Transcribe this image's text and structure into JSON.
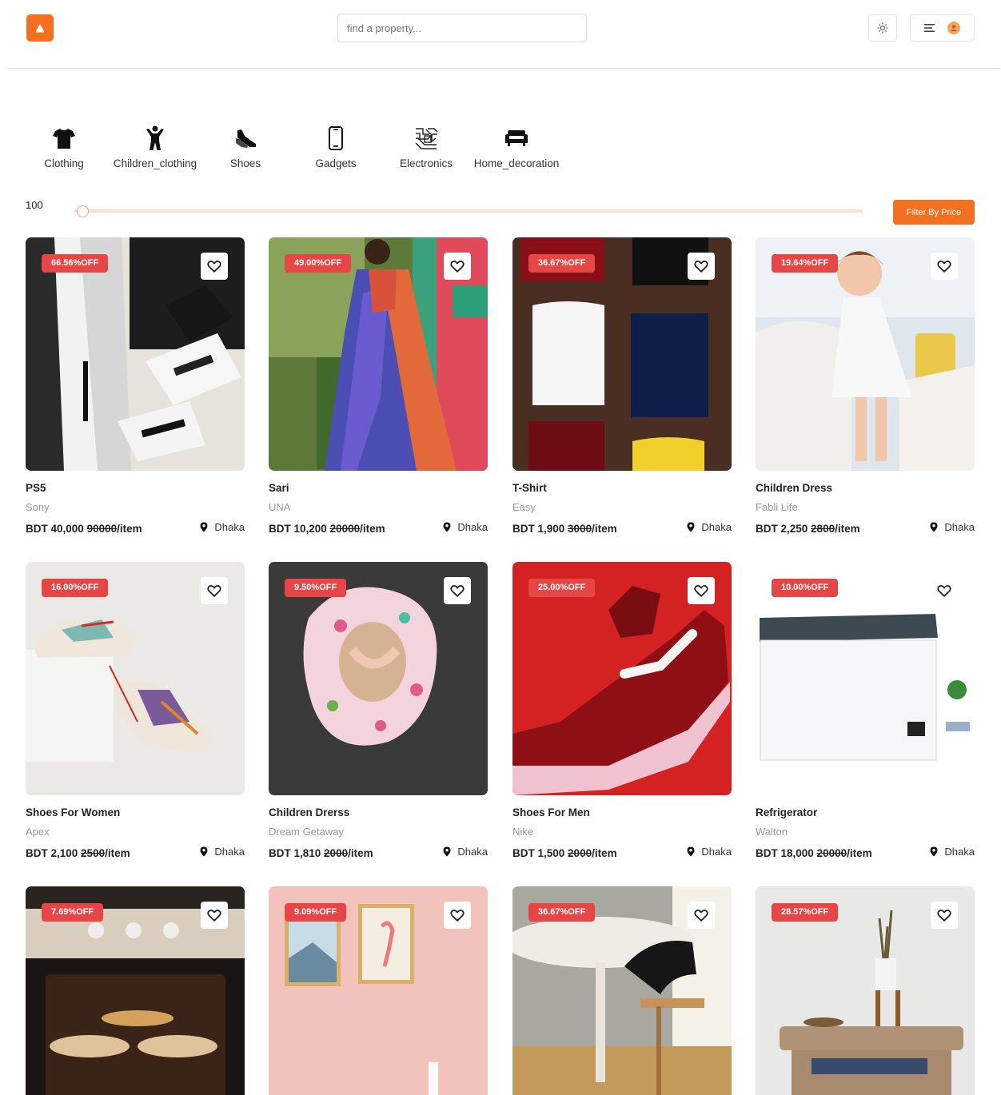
{
  "header": {
    "search_placeholder": "find a property..."
  },
  "categories": [
    {
      "label": "Clothing",
      "icon": "tshirt-icon"
    },
    {
      "label": "Children_clothing",
      "icon": "child-icon"
    },
    {
      "label": "Shoes",
      "icon": "shoe-icon"
    },
    {
      "label": "Gadgets",
      "icon": "phone-icon"
    },
    {
      "label": "Electronics",
      "icon": "circuit-icon"
    },
    {
      "label": "Home_decoration",
      "icon": "sofa-icon"
    }
  ],
  "price_filter": {
    "value": "100",
    "level": 0.0,
    "button_label": "Filter By Price"
  },
  "colors": {
    "accent": "#f37021",
    "badge": "#e64646"
  },
  "products": [
    {
      "discount": "66.56%OFF",
      "title": "PS5",
      "brand": "Sony",
      "price": "BDT 40,000",
      "old_price": "90000",
      "unit": "/item",
      "location": "Dhaka"
    },
    {
      "discount": "49.00%OFF",
      "title": "Sari",
      "brand": "UNA",
      "price": "BDT 10,200",
      "old_price": "20000",
      "unit": "/item",
      "location": "Dhaka"
    },
    {
      "discount": "36.67%OFF",
      "title": "T-Shirt",
      "brand": "Easy",
      "price": "BDT 1,900",
      "old_price": "3000",
      "unit": "/item",
      "location": "Dhaka"
    },
    {
      "discount": "19.64%OFF",
      "title": "Children Dress",
      "brand": "Fabli Life",
      "price": "BDT 2,250",
      "old_price": "2800",
      "unit": "/item",
      "location": "Dhaka"
    },
    {
      "discount": "16.00%OFF",
      "title": "Shoes For Women",
      "brand": "Apex",
      "price": "BDT 2,100",
      "old_price": "2500",
      "unit": "/item",
      "location": "Dhaka"
    },
    {
      "discount": "9.50%OFF",
      "title": "Children Drerss",
      "brand": "Dream Getaway",
      "price": "BDT 1,810",
      "old_price": "2000",
      "unit": "/item",
      "location": "Dhaka"
    },
    {
      "discount": "25.00%OFF",
      "title": "Shoes For Men",
      "brand": "Nike",
      "price": "BDT 1,500",
      "old_price": "2000",
      "unit": "/item",
      "location": "Dhaka"
    },
    {
      "discount": "10.00%OFF",
      "title": "Refrigerator",
      "brand": "Walton",
      "price": "BDT 18,000",
      "old_price": "20000",
      "unit": "/item",
      "location": "Dhaka"
    },
    {
      "discount": "7.69%OFF"
    },
    {
      "discount": "9.09%OFF"
    },
    {
      "discount": "36.67%OFF"
    },
    {
      "discount": "28.57%OFF"
    }
  ]
}
